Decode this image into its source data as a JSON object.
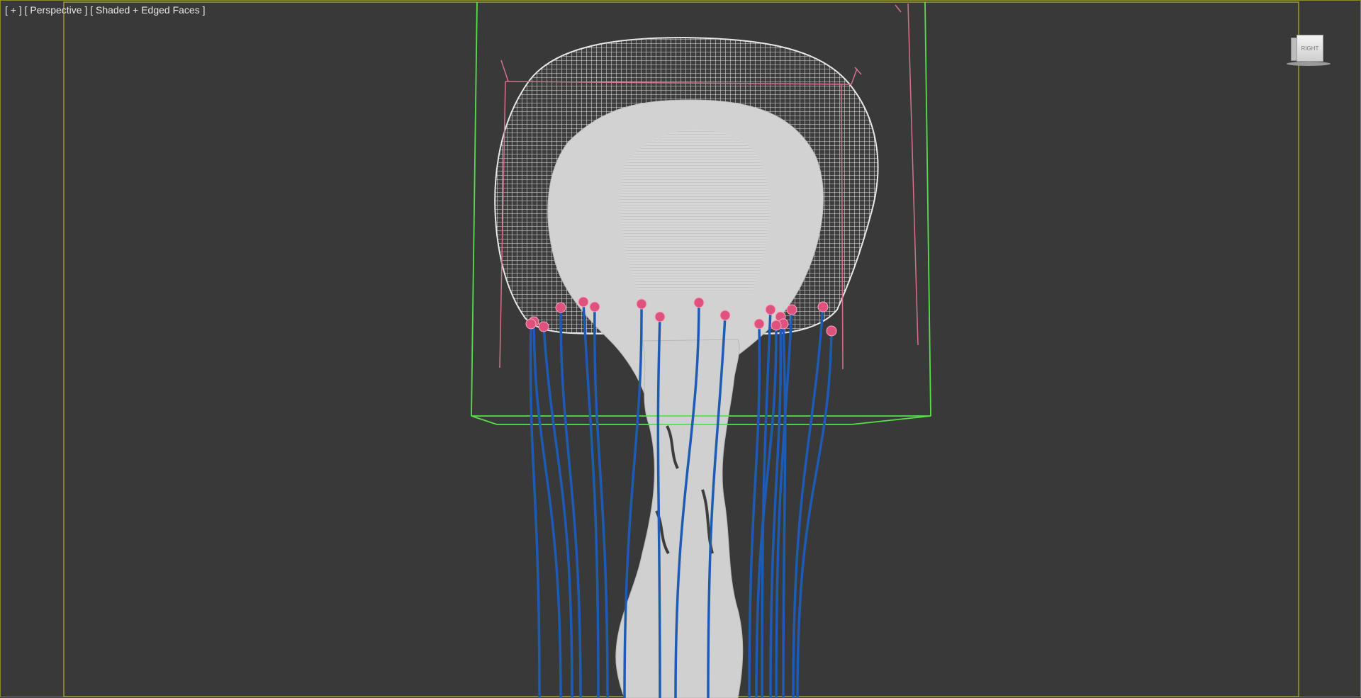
{
  "viewport": {
    "menu_label": "[ + ]",
    "view_label": "[ Perspective ]",
    "shading_label": "[ Shaded + Edged Faces ]",
    "viewcube_label": "RIGHT"
  },
  "colors": {
    "background": "#393939",
    "safe_frame": "#9c9c2a",
    "selection_box": "#58e04a",
    "helper_lines": "#d8708c",
    "tentacle_splines": "#1e5bb5",
    "spline_vertices": "#e0527e",
    "mesh": "#d4d4d4"
  },
  "icons": [
    "viewcube-icon"
  ]
}
